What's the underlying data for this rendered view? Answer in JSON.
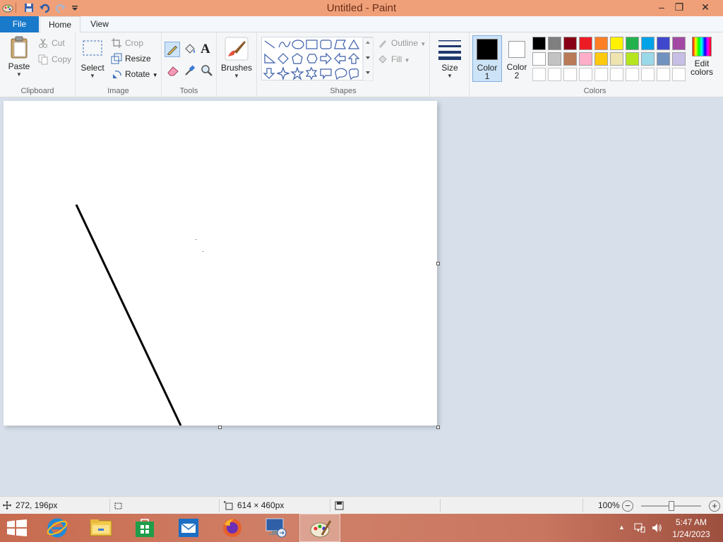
{
  "window": {
    "title": "Untitled - Paint"
  },
  "title_buttons": {
    "minimize": "–",
    "restore": "❐",
    "close": "✕"
  },
  "tabs": {
    "file": "File",
    "home": "Home",
    "view": "View"
  },
  "clipboard": {
    "paste": "Paste",
    "cut": "Cut",
    "copy": "Copy",
    "label": "Clipboard"
  },
  "image": {
    "select": "Select",
    "crop": "Crop",
    "resize": "Resize",
    "rotate": "Rotate",
    "label": "Image"
  },
  "tools": {
    "label": "Tools"
  },
  "brushes": {
    "label": "Brushes"
  },
  "shapes": {
    "outline": "Outline",
    "fill": "Fill",
    "label": "Shapes"
  },
  "size": {
    "label": "Size"
  },
  "colors": {
    "color1_line1": "Color",
    "color1_line2": "1",
    "color2_line1": "Color",
    "color2_line2": "2",
    "edit_line1": "Edit",
    "edit_line2": "colors",
    "label": "Colors",
    "color1_value": "#000000",
    "color2_value": "#ffffff",
    "palette_row1": [
      "#000000",
      "#7f7f7f",
      "#880015",
      "#ed1c24",
      "#ff7f27",
      "#fff200",
      "#22b14c",
      "#00a2e8",
      "#3f48cc",
      "#a349a4"
    ],
    "palette_row2": [
      "#ffffff",
      "#c3c3c3",
      "#b97a57",
      "#ffaec9",
      "#ffc90e",
      "#efe4b0",
      "#b5e61d",
      "#99d9ea",
      "#7092be",
      "#c8bfe7"
    ]
  },
  "status": {
    "cursor": "272, 196px",
    "canvas_size": "614 × 460px",
    "zoom": "100%",
    "zoom_level": 1.0
  },
  "tray": {
    "time": "5:47 AM",
    "date": "1/24/2023"
  }
}
